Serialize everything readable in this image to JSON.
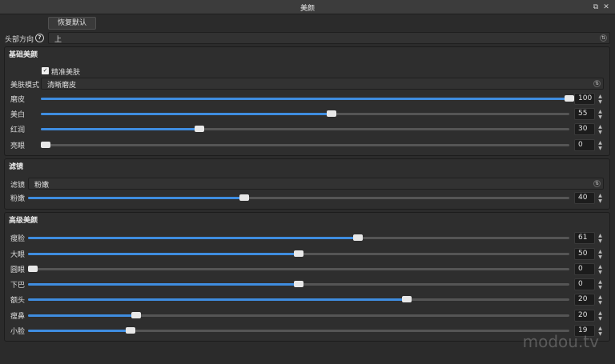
{
  "window": {
    "title": "美颜",
    "float_icon": "float-icon",
    "close_icon": "close-icon"
  },
  "reset_button": "恢复默认",
  "head_direction": {
    "label": "头部方向",
    "value": "上",
    "help_icon": "help-icon"
  },
  "basic": {
    "title": "基础美颜",
    "precise_label": "精准美肤",
    "precise_checked": true,
    "mode_label": "美肤模式",
    "mode_value": "清晰磨皮",
    "sliders": [
      {
        "label": "磨皮",
        "value": "100",
        "percent": 100
      },
      {
        "label": "美白",
        "value": "55",
        "percent": 55
      },
      {
        "label": "红润",
        "value": "30",
        "percent": 30
      },
      {
        "label": "亮眼",
        "value": "0",
        "percent": 0
      }
    ]
  },
  "filter": {
    "title": "滤镜",
    "combo_label": "滤镜",
    "combo_value": "粉嫩",
    "slider": {
      "label": "粉嫩",
      "value": "40",
      "percent": 40
    }
  },
  "advanced": {
    "title": "高级美颜",
    "sliders": [
      {
        "label": "瘦脸",
        "value": "61",
        "percent": 61
      },
      {
        "label": "大眼",
        "value": "50",
        "percent": 50
      },
      {
        "label": "圆眼",
        "value": "0",
        "percent": 0
      },
      {
        "label": "下巴",
        "value": "0",
        "percent": 50
      },
      {
        "label": "额头",
        "value": "20",
        "percent": 70
      },
      {
        "label": "瘦鼻",
        "value": "20",
        "percent": 20
      },
      {
        "label": "小脸",
        "value": "19",
        "percent": 19
      }
    ]
  },
  "watermark": "modou.tv",
  "colors": {
    "accent": "#3f8de0",
    "background": "#2b2b2b"
  }
}
